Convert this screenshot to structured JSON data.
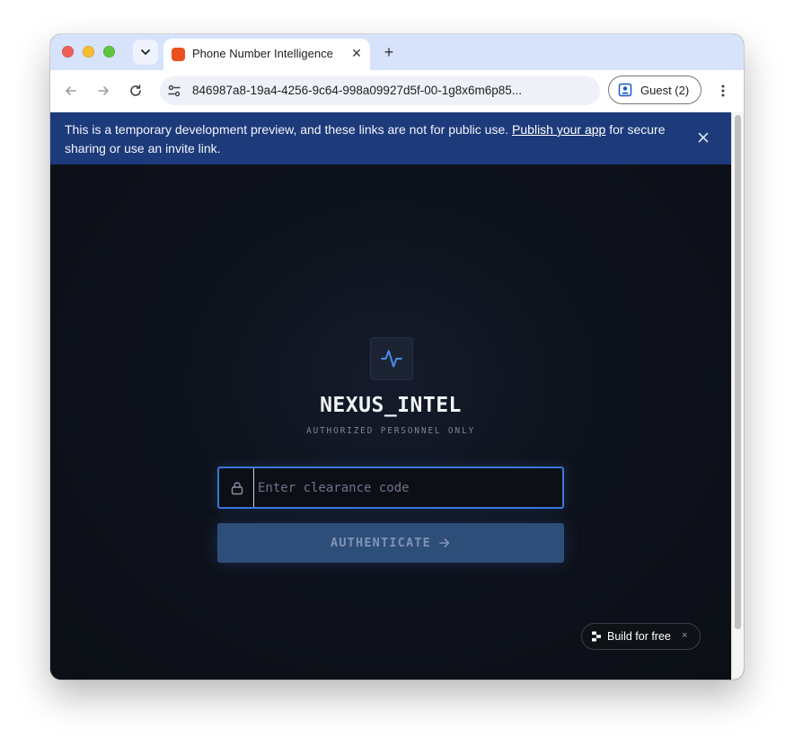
{
  "browser": {
    "tab": {
      "title": "Phone Number Intelligence",
      "favicon_color": "#e8501f",
      "close_glyph": "✕"
    },
    "new_tab_glyph": "+",
    "url": "846987a8-19a4-4256-9c64-998a09927d5f-00-1g8x6m6p85...",
    "profile_label": "Guest (2)"
  },
  "banner": {
    "text_before": "This is a temporary development preview, and these links are not for public use. ",
    "link_text": "Publish your app",
    "text_after": " for secure sharing or use an invite link."
  },
  "app": {
    "title": "NEXUS_INTEL",
    "subtitle": "AUTHORIZED PERSONNEL ONLY",
    "input_placeholder": "Enter clearance code",
    "input_value": "",
    "button_label": "AUTHENTICATE",
    "accent_color": "#3b76d6"
  },
  "build_badge": {
    "label": "Build for free",
    "close_glyph": "×"
  }
}
